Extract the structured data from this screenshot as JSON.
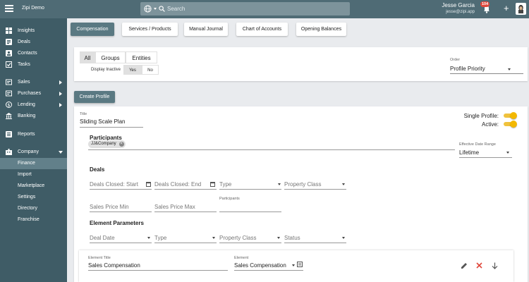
{
  "topbar": {
    "app_title": "Zipi Demo",
    "search_placeholder": "Search",
    "user_name": "Jesse Garcia",
    "user_email": "jesse@zipi.app",
    "notification_count": "104",
    "plus": "+"
  },
  "sidebar": {
    "items": [
      {
        "label": "Insights",
        "icon": "grid-icon"
      },
      {
        "label": "Deals",
        "icon": "deals-icon"
      },
      {
        "label": "Contacts",
        "icon": "contacts-icon"
      },
      {
        "label": "Tasks",
        "icon": "tasks-icon"
      },
      {
        "label": "Sales",
        "icon": "sales-icon"
      },
      {
        "label": "Purchases",
        "icon": "purchases-icon"
      },
      {
        "label": "Lending",
        "icon": "lending-icon"
      },
      {
        "label": "Banking",
        "icon": "bank-icon"
      },
      {
        "label": "Reports",
        "icon": "reports-icon"
      },
      {
        "label": "Company",
        "icon": "company-icon"
      }
    ],
    "company_sub": [
      "Finance",
      "Import",
      "Marketplace",
      "Settings",
      "Directory",
      "Franchise"
    ]
  },
  "tabs": [
    "Compensation",
    "Services / Products",
    "Manual Journal",
    "Chart of Accounts",
    "Opening Balances"
  ],
  "filter": {
    "segments": [
      "All",
      "Groups",
      "Entities"
    ],
    "display_inactive_label": "Display Inactive",
    "yes": "Yes",
    "no": "No",
    "order_label": "Order",
    "order_value": "Profile Priority"
  },
  "create_profile": "Create Profile",
  "profile": {
    "title_label": "Title",
    "title_value": "Sliding Scale Plan",
    "single_profile_label": "Single Profile:",
    "active_label": "Active:",
    "participants_heading": "Participants",
    "participant_chip": "JJ&Company",
    "effective_date_label": "Effective Date Range",
    "effective_date_value": "Lifetime",
    "deals_heading": "Deals",
    "deals_closed_start": "Deals Closed: Start",
    "deals_closed_end": "Deals Closed: End",
    "type": "Type",
    "property_class": "Property Class",
    "sales_price_min": "Sales Price Min",
    "sales_price_max": "Sales Price Max",
    "participants_label": "Participants",
    "element_params_heading": "Element Parameters",
    "deal_date": "Deal Date",
    "param_type": "Type",
    "param_property_class": "Property Class",
    "status": "Status",
    "element_title_label": "Element Title",
    "element_title_value": "Sales Compensation",
    "element_label": "Element",
    "element_value": "Sales Compensation"
  },
  "colors": {
    "topbar": "#4f6b75",
    "sidebar": "#3f5c66",
    "accent": "#5a7982",
    "toggle": "#f3b800",
    "delete": "#e0483c"
  }
}
